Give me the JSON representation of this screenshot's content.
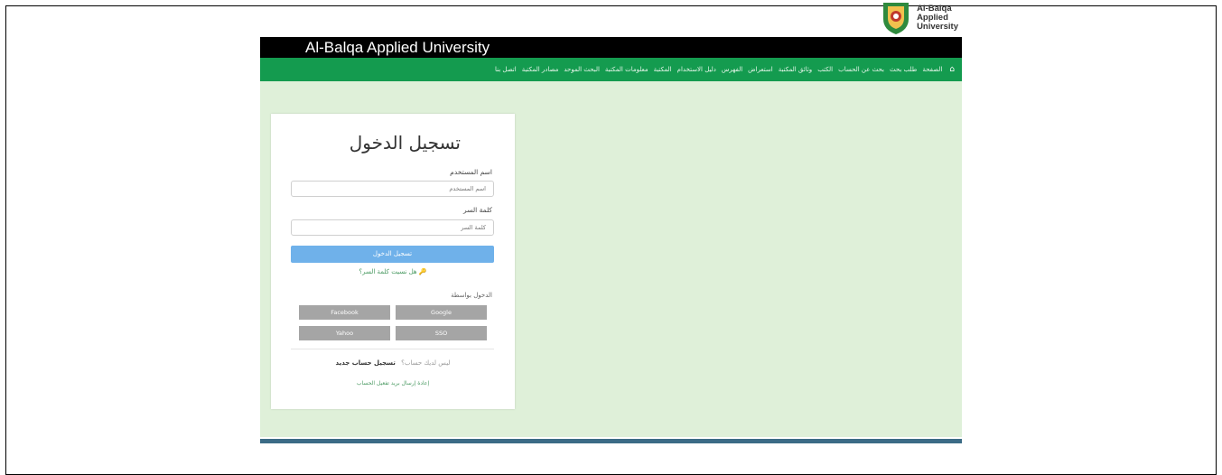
{
  "logo": {
    "line1": "Al-Balqa",
    "line2": "Applied",
    "line3": "University",
    "emblem_icon": "university-emblem-icon"
  },
  "header": {
    "title": "Al-Balqa Applied University"
  },
  "nav": {
    "home_icon": "home-icon",
    "items": [
      "الصفحة",
      "طلب بحث",
      "بحث عن الحساب",
      "الكتب",
      "وثائق المكتبة",
      "استعراض",
      "الفهرس",
      "دليل الاستخدام",
      "المكتبة",
      "معلومات المكتبة",
      "البحث الموحد",
      "مصادر المكتبة",
      "اتصل بنا"
    ]
  },
  "login": {
    "title": "تسجيل الدخول",
    "username_label": "اسم المستخدم",
    "username_placeholder": "اسم المستخدم",
    "password_label": "كلمة السر",
    "password_placeholder": "كلمة السر",
    "submit_label": "تسجيل الدخول",
    "forgot_label": "هل نسيت كلمة السر؟",
    "via_label": "الدخول بواسطة",
    "social": [
      {
        "label": "Google",
        "icon": "google-icon"
      },
      {
        "label": "Facebook",
        "icon": "facebook-icon"
      },
      {
        "label": "SSO",
        "icon": "key-icon"
      },
      {
        "label": "Yahoo",
        "icon": "yahoo-icon"
      }
    ],
    "no_account_text": "ليس لديك حساب؟",
    "register_label": "تسجيل حساب جديد",
    "activation_label": "إعادة إرسال بريد تفعيل الحساب"
  },
  "colors": {
    "nav_green": "#149b4f",
    "content_bg": "#dff0d9",
    "button_blue": "#6fb1ea",
    "social_grey": "#a5a5a5"
  }
}
